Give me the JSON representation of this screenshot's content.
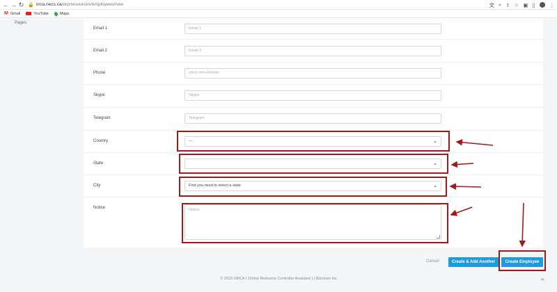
{
  "browser": {
    "url_domain": "orca.necs.ca",
    "url_path": "/erp/resources/employees/new",
    "bookmarks": [
      "Gmail",
      "YouTube",
      "Maps"
    ]
  },
  "sidebar": {
    "pages_label": "Pages"
  },
  "form": {
    "email1": {
      "label": "Email 1",
      "placeholder": "Email 1"
    },
    "email2": {
      "label": "Email 2",
      "placeholder": "Email 2"
    },
    "phone": {
      "label": "Phone",
      "placeholder": "(###) ###-######"
    },
    "skype": {
      "label": "Skype",
      "placeholder": "Skype"
    },
    "telegram": {
      "label": "Telegram",
      "placeholder": "Telegram"
    },
    "country": {
      "label": "Country",
      "value": "---"
    },
    "state": {
      "label": "State",
      "value": ""
    },
    "city": {
      "label": "City",
      "value": "First you need to select a state"
    },
    "notice": {
      "label": "Notice",
      "placeholder": "Notice"
    }
  },
  "actions": {
    "cancel": "Cancel",
    "create_add_another": "Create & Add Another",
    "create_employee": "Create Employee"
  },
  "footer": "© 2023 ORCA ( Online Resource Controller Assistant ) | Bizomex Inc",
  "colors": {
    "primary_button": "#1e9bde",
    "highlight": "#a11818"
  }
}
